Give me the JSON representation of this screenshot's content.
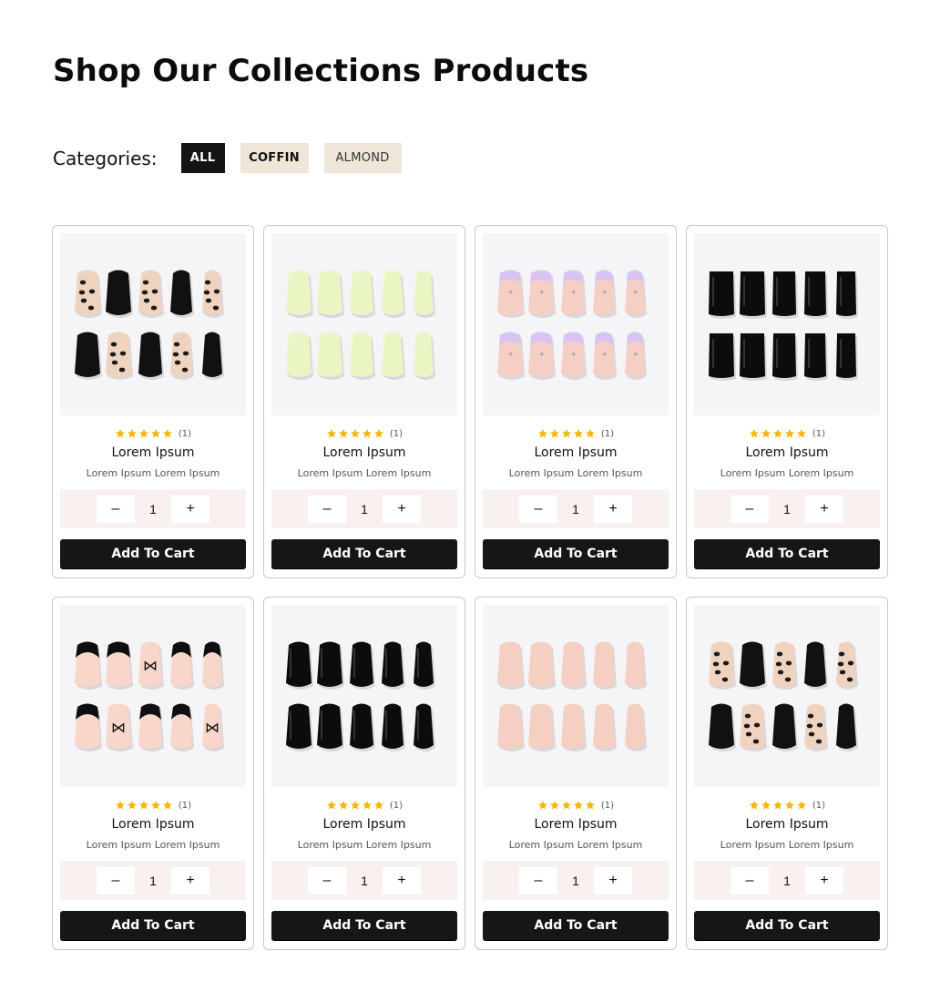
{
  "page_title": "Shop Our Collections Products",
  "categories": {
    "label": "Categories:",
    "items": [
      {
        "label": "ALL",
        "active": true
      },
      {
        "label": "COFFIN",
        "active": false
      },
      {
        "label": "ALMOND",
        "active": false
      }
    ]
  },
  "colors": {
    "accent_dark": "#141414",
    "chip_bg": "#efe6d9",
    "star": "#f5b60a",
    "qty_bg": "#f8f1ef",
    "image_bg": "#f5f4f7"
  },
  "products": [
    {
      "name": "Lorem Ipsum",
      "subtitle": "Lorem Ipsum Lorem Ipsum",
      "rating_count": "(1)",
      "stars": 5,
      "quantity": "1",
      "add_label": "Add To Cart",
      "minus_label": "–",
      "plus_label": "+",
      "design": "leopard"
    },
    {
      "name": "Lorem Ipsum",
      "subtitle": "Lorem Ipsum Lorem Ipsum",
      "rating_count": "(1)",
      "stars": 5,
      "quantity": "1",
      "add_label": "Add To Cart",
      "minus_label": "–",
      "plus_label": "+",
      "design": "lime"
    },
    {
      "name": "Lorem Ipsum",
      "subtitle": "Lorem Ipsum Lorem Ipsum",
      "rating_count": "(1)",
      "stars": 5,
      "quantity": "1",
      "add_label": "Add To Cart",
      "minus_label": "–",
      "plus_label": "+",
      "design": "lilac-sparkle"
    },
    {
      "name": "Lorem Ipsum",
      "subtitle": "Lorem Ipsum Lorem Ipsum",
      "rating_count": "(1)",
      "stars": 5,
      "quantity": "1",
      "add_label": "Add To Cart",
      "minus_label": "–",
      "plus_label": "+",
      "design": "black-square"
    },
    {
      "name": "Lorem Ipsum",
      "subtitle": "Lorem Ipsum Lorem Ipsum",
      "rating_count": "(1)",
      "stars": 5,
      "quantity": "1",
      "add_label": "Add To Cart",
      "minus_label": "–",
      "plus_label": "+",
      "design": "french-bow"
    },
    {
      "name": "Lorem Ipsum",
      "subtitle": "Lorem Ipsum Lorem Ipsum",
      "rating_count": "(1)",
      "stars": 5,
      "quantity": "1",
      "add_label": "Add To Cart",
      "minus_label": "–",
      "plus_label": "+",
      "design": "black-gloss"
    },
    {
      "name": "Lorem Ipsum",
      "subtitle": "Lorem Ipsum Lorem Ipsum",
      "rating_count": "(1)",
      "stars": 5,
      "quantity": "1",
      "add_label": "Add To Cart",
      "minus_label": "–",
      "plus_label": "+",
      "design": "nude"
    },
    {
      "name": "Lorem Ipsum",
      "subtitle": "Lorem Ipsum Lorem Ipsum",
      "rating_count": "(1)",
      "stars": 5,
      "quantity": "1",
      "add_label": "Add To Cart",
      "minus_label": "–",
      "plus_label": "+",
      "design": "leopard"
    }
  ]
}
